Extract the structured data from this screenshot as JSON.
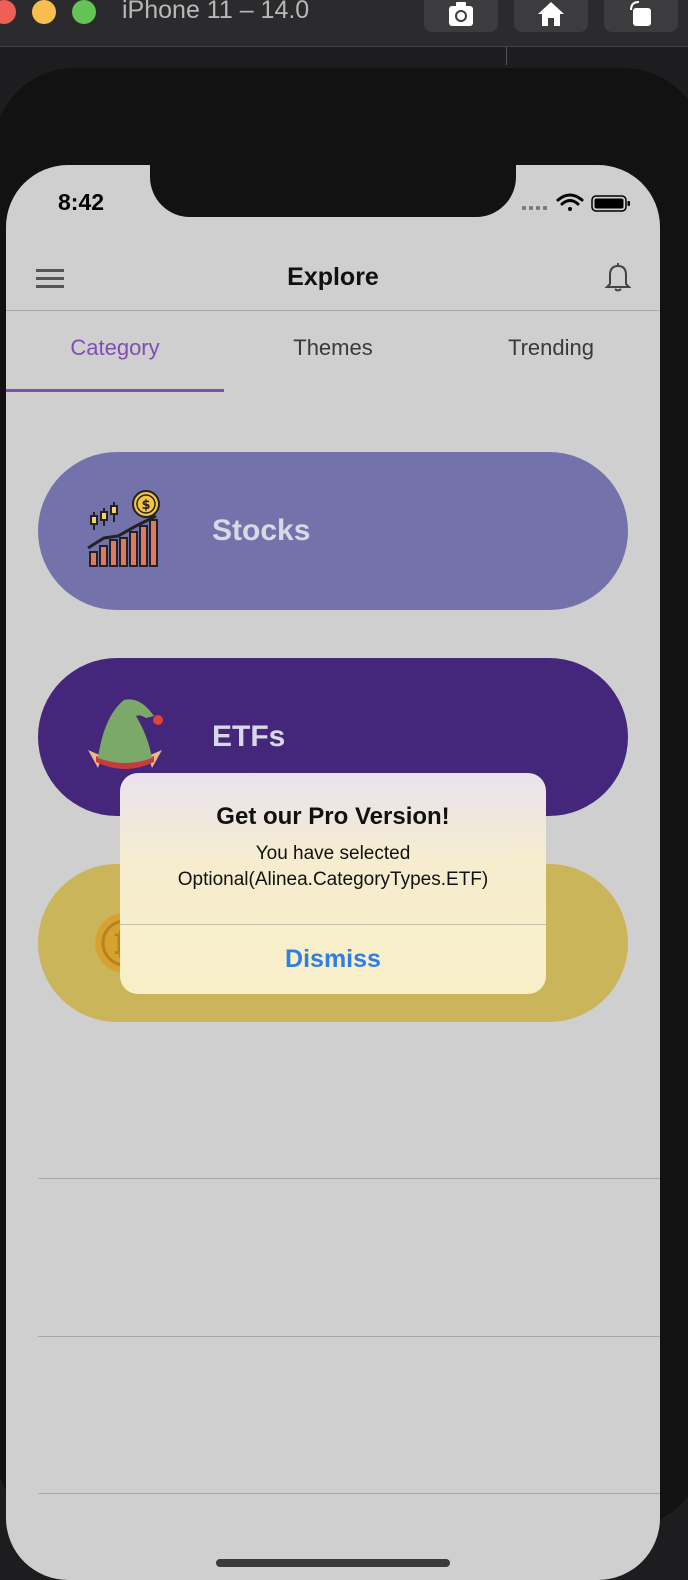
{
  "window": {
    "title": "iPhone 11 – 14.0",
    "toolbar_icons": [
      "camera-icon",
      "home-icon",
      "rotate-icon"
    ]
  },
  "status_bar": {
    "time": "8:42"
  },
  "navbar": {
    "title": "Explore"
  },
  "tabs": [
    {
      "label": "Category",
      "selected": true
    },
    {
      "label": "Themes",
      "selected": false
    },
    {
      "label": "Trending",
      "selected": false
    }
  ],
  "categories": [
    {
      "label": "Stocks",
      "color": "#7472ab"
    },
    {
      "label": "ETFs",
      "color": "#44267a"
    },
    {
      "label": "",
      "color": "#cbb55a"
    }
  ],
  "alert": {
    "title": "Get our Pro Version!",
    "message_line1": "You have selected",
    "message_line2": "Optional(Alinea.CategoryTypes.ETF)",
    "dismiss_label": "Dismiss"
  },
  "colors": {
    "accent": "#7e4fb3",
    "alert_button": "#2f7fe0"
  }
}
